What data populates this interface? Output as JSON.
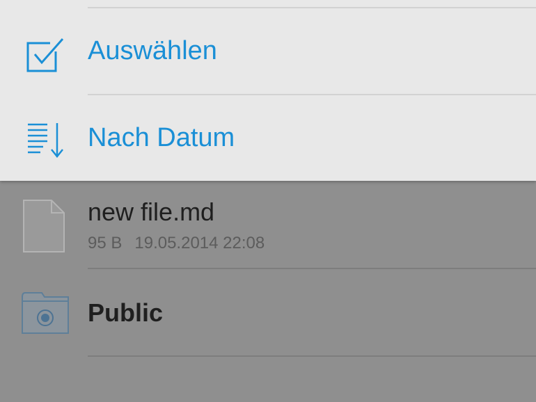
{
  "menu": {
    "items": [
      {
        "label": "Auswählen",
        "icon": "checkbox-icon"
      },
      {
        "label": "Nach Datum",
        "icon": "sort-descending-icon"
      }
    ],
    "accent_color": "#1a8fd6"
  },
  "files": [
    {
      "name": "new file.md",
      "size": "95 B",
      "modified": "19.05.2014 22:08",
      "icon": "document-icon"
    },
    {
      "name": "Public",
      "icon": "public-folder-icon"
    }
  ]
}
